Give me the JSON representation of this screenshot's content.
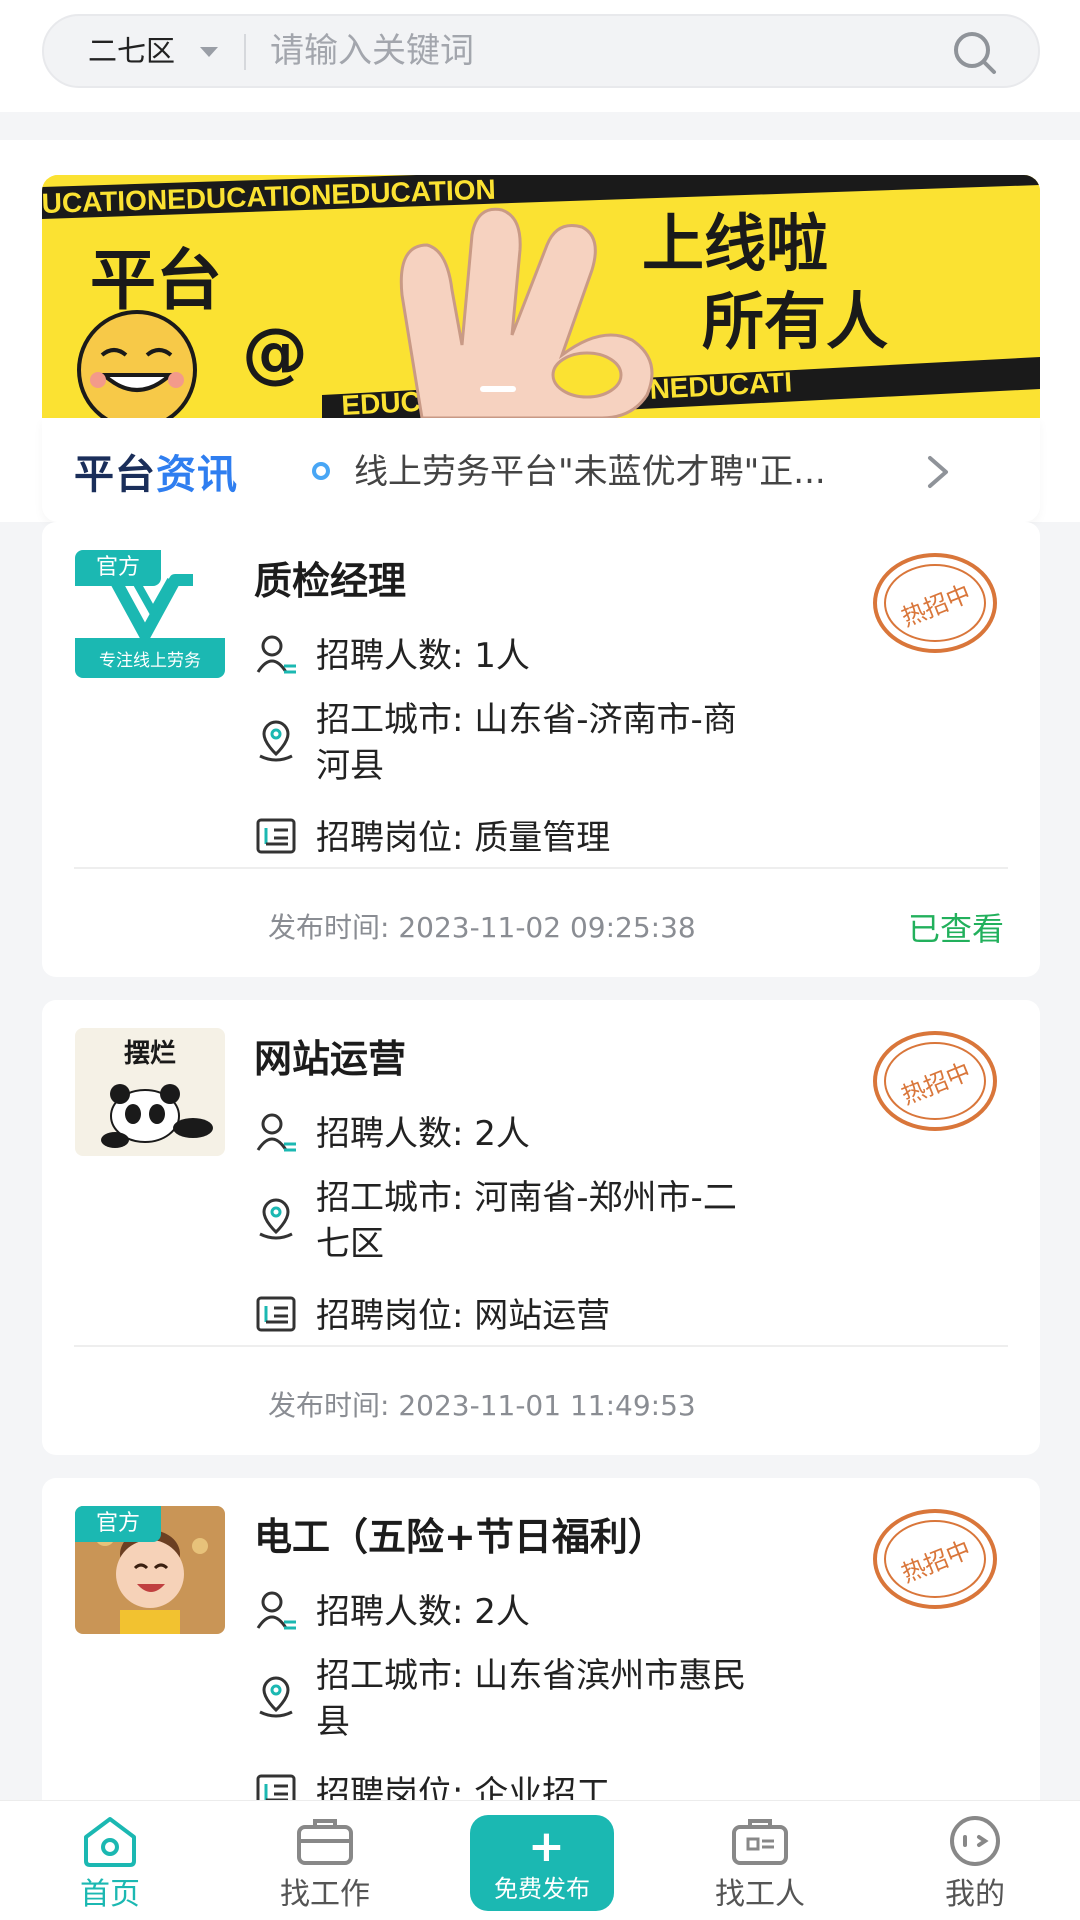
{
  "search": {
    "region": "二七区",
    "placeholder": "请输入关键词"
  },
  "banner": {
    "text_left": "平台",
    "text_at": "@",
    "text_right_1": "上线啦",
    "text_right_2": "所有人",
    "strip_top": "UCATIONEDUCATIONEDUCATION",
    "strip_bottom": "EDUCATIONEDUCATIONEDUCATI"
  },
  "news": {
    "logo_part1": "平台",
    "logo_part2": "资讯",
    "headline": "线上劳务平台\"未蓝优才聘\"正..."
  },
  "jobs": [
    {
      "title": "质检经理",
      "official_badge": "官方",
      "thumb_caption": "专注线上劳务",
      "count_label": "招聘人数:",
      "count": "1人",
      "city_label": "招工城市:",
      "city_line1": "山东省-济南市-商",
      "city_line2": "河县",
      "post_label": "招聘岗位:",
      "post": "质量管理",
      "stamp": "热招中",
      "time": "发布时间:  2023-11-02 09:25:38",
      "viewed": "已查看"
    },
    {
      "title": "网站运营",
      "thumb_caption": "摆烂",
      "count_label": "招聘人数:",
      "count": "2人",
      "city_label": "招工城市:",
      "city_line1": "河南省-郑州市-二",
      "city_line2": "七区",
      "post_label": "招聘岗位:",
      "post": "网站运营",
      "stamp": "热招中",
      "time": "发布时间:  2023-11-01 11:49:53"
    },
    {
      "title": "电工（五险+节日福利）",
      "official_badge": "官方",
      "count_label": "招聘人数:",
      "count": "2人",
      "city_label": "招工城市:",
      "city_line1": "山东省滨州市惠民",
      "city_line2": "县",
      "post_label": "招聘岗位:",
      "post": "企业招工",
      "stamp": "热招中"
    }
  ],
  "tabbar": {
    "home": "首页",
    "find_job": "找工作",
    "publish": "免费发布",
    "find_worker": "找工人",
    "mine": "我的"
  },
  "colors": {
    "accent": "#1bb8b2",
    "viewed_green": "#22b05c",
    "stamp_orange": "#d9763a",
    "banner_yellow": "#fbe232"
  }
}
